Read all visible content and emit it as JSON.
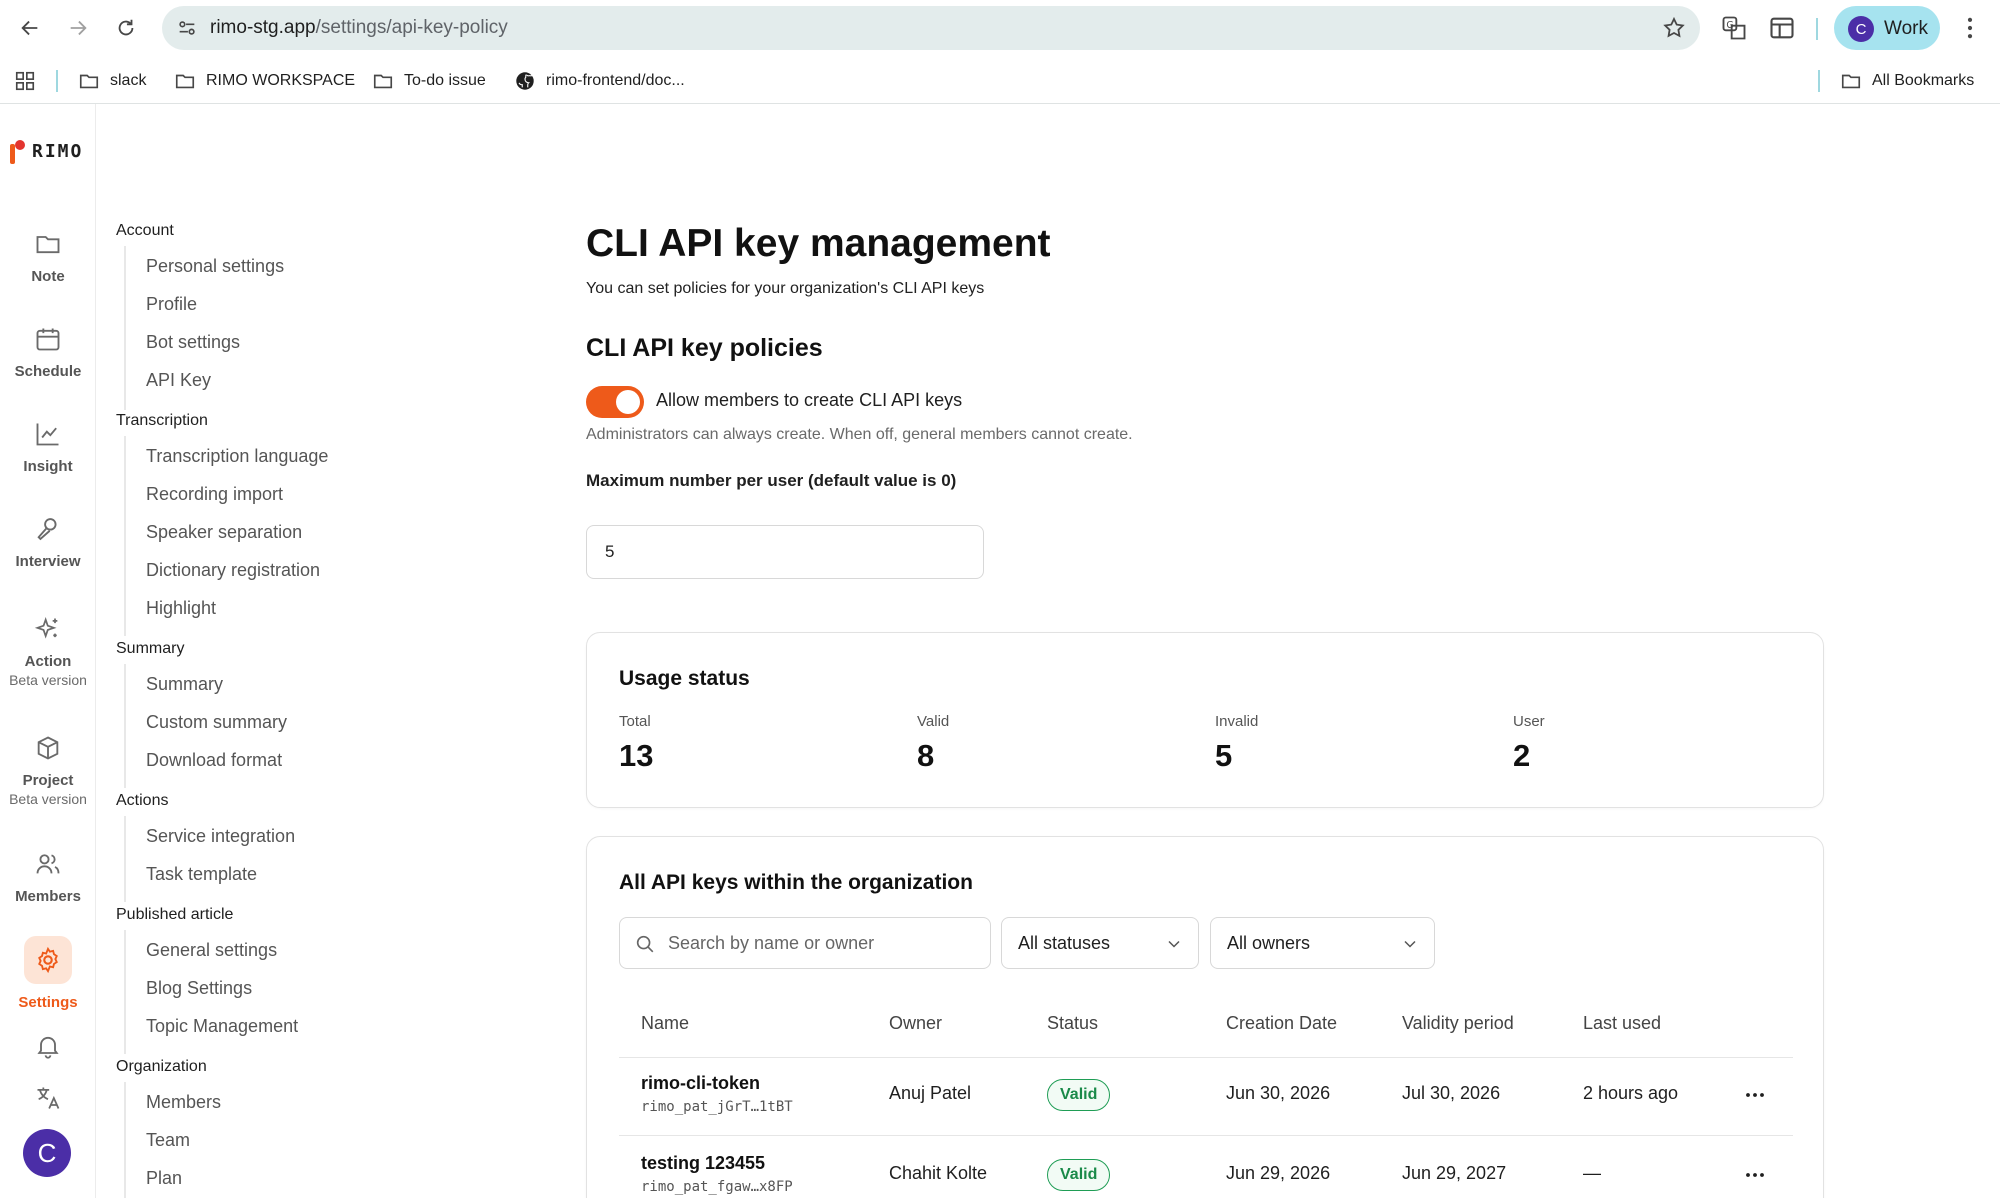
{
  "browser": {
    "url_host": "rimo-stg.app",
    "url_path": "/settings/api-key-policy",
    "profile_initial": "C",
    "profile_label": "Work",
    "bookmarks": [
      {
        "label": "slack",
        "icon": "folder-icon"
      },
      {
        "label": "RIMO WORKSPACE",
        "icon": "folder-icon"
      },
      {
        "label": "To-do issue",
        "icon": "folder-icon"
      },
      {
        "label": "rimo-frontend/doc...",
        "icon": "github-icon"
      }
    ],
    "all_bookmarks": "All Bookmarks"
  },
  "rail": {
    "logo": "RIMO",
    "items": [
      {
        "label": "Note",
        "sub": ""
      },
      {
        "label": "Schedule",
        "sub": ""
      },
      {
        "label": "Insight",
        "sub": ""
      },
      {
        "label": "Interview",
        "sub": ""
      },
      {
        "label": "Action",
        "sub": "Beta version"
      },
      {
        "label": "Project",
        "sub": "Beta version"
      },
      {
        "label": "Members",
        "sub": ""
      },
      {
        "label": "Settings",
        "sub": ""
      }
    ],
    "avatar_initial": "C",
    "accent": "#ee5a1a"
  },
  "settings_nav": {
    "groups": [
      {
        "title": "Account",
        "items": [
          "Personal settings",
          "Profile",
          "Bot settings",
          "API Key"
        ]
      },
      {
        "title": "Transcription",
        "items": [
          "Transcription language",
          "Recording import",
          "Speaker separation",
          "Dictionary registration",
          "Highlight"
        ]
      },
      {
        "title": "Summary",
        "items": [
          "Summary",
          "Custom summary",
          "Download format"
        ]
      },
      {
        "title": "Actions",
        "items": [
          "Service integration",
          "Task template"
        ]
      },
      {
        "title": "Published article",
        "items": [
          "General settings",
          "Blog Settings",
          "Topic Management"
        ]
      },
      {
        "title": "Organization",
        "items": [
          "Members",
          "Team",
          "Plan"
        ]
      }
    ]
  },
  "main": {
    "title": "CLI API key management",
    "subtitle": "You can set policies for your organization's CLI API keys",
    "policies_title": "CLI API key policies",
    "toggle_label": "Allow members to create CLI API keys",
    "toggle_on": true,
    "toggle_help": "Administrators can always create. When off, general members cannot create.",
    "max_label": "Maximum number per user (default value is 0)",
    "max_value": "5"
  },
  "usage": {
    "title": "Usage status",
    "stats": [
      {
        "label": "Total",
        "value": "13"
      },
      {
        "label": "Valid",
        "value": "8"
      },
      {
        "label": "Invalid",
        "value": "5"
      },
      {
        "label": "User",
        "value": "2"
      }
    ]
  },
  "keys": {
    "title": "All API keys within the organization",
    "search_placeholder": "Search by name or owner",
    "status_filter": "All statuses",
    "owner_filter": "All owners",
    "columns": [
      "Name",
      "Owner",
      "Status",
      "Creation Date",
      "Validity period",
      "Last used"
    ],
    "rows": [
      {
        "name": "rimo-cli-token",
        "key": "rimo_pat_jGrT…1tBT",
        "owner": "Anuj Patel",
        "status": "Valid",
        "created": "Jun 30, 2026",
        "validity": "Jul 30, 2026",
        "last_used": "2 hours ago"
      },
      {
        "name": "testing 123455",
        "key": "rimo_pat_fgaw…x8FP",
        "owner": "Chahit Kolte",
        "status": "Valid",
        "created": "Jun 29, 2026",
        "validity": "Jun 29, 2027",
        "last_used": "—"
      }
    ],
    "status_color": "#1a8a49"
  }
}
